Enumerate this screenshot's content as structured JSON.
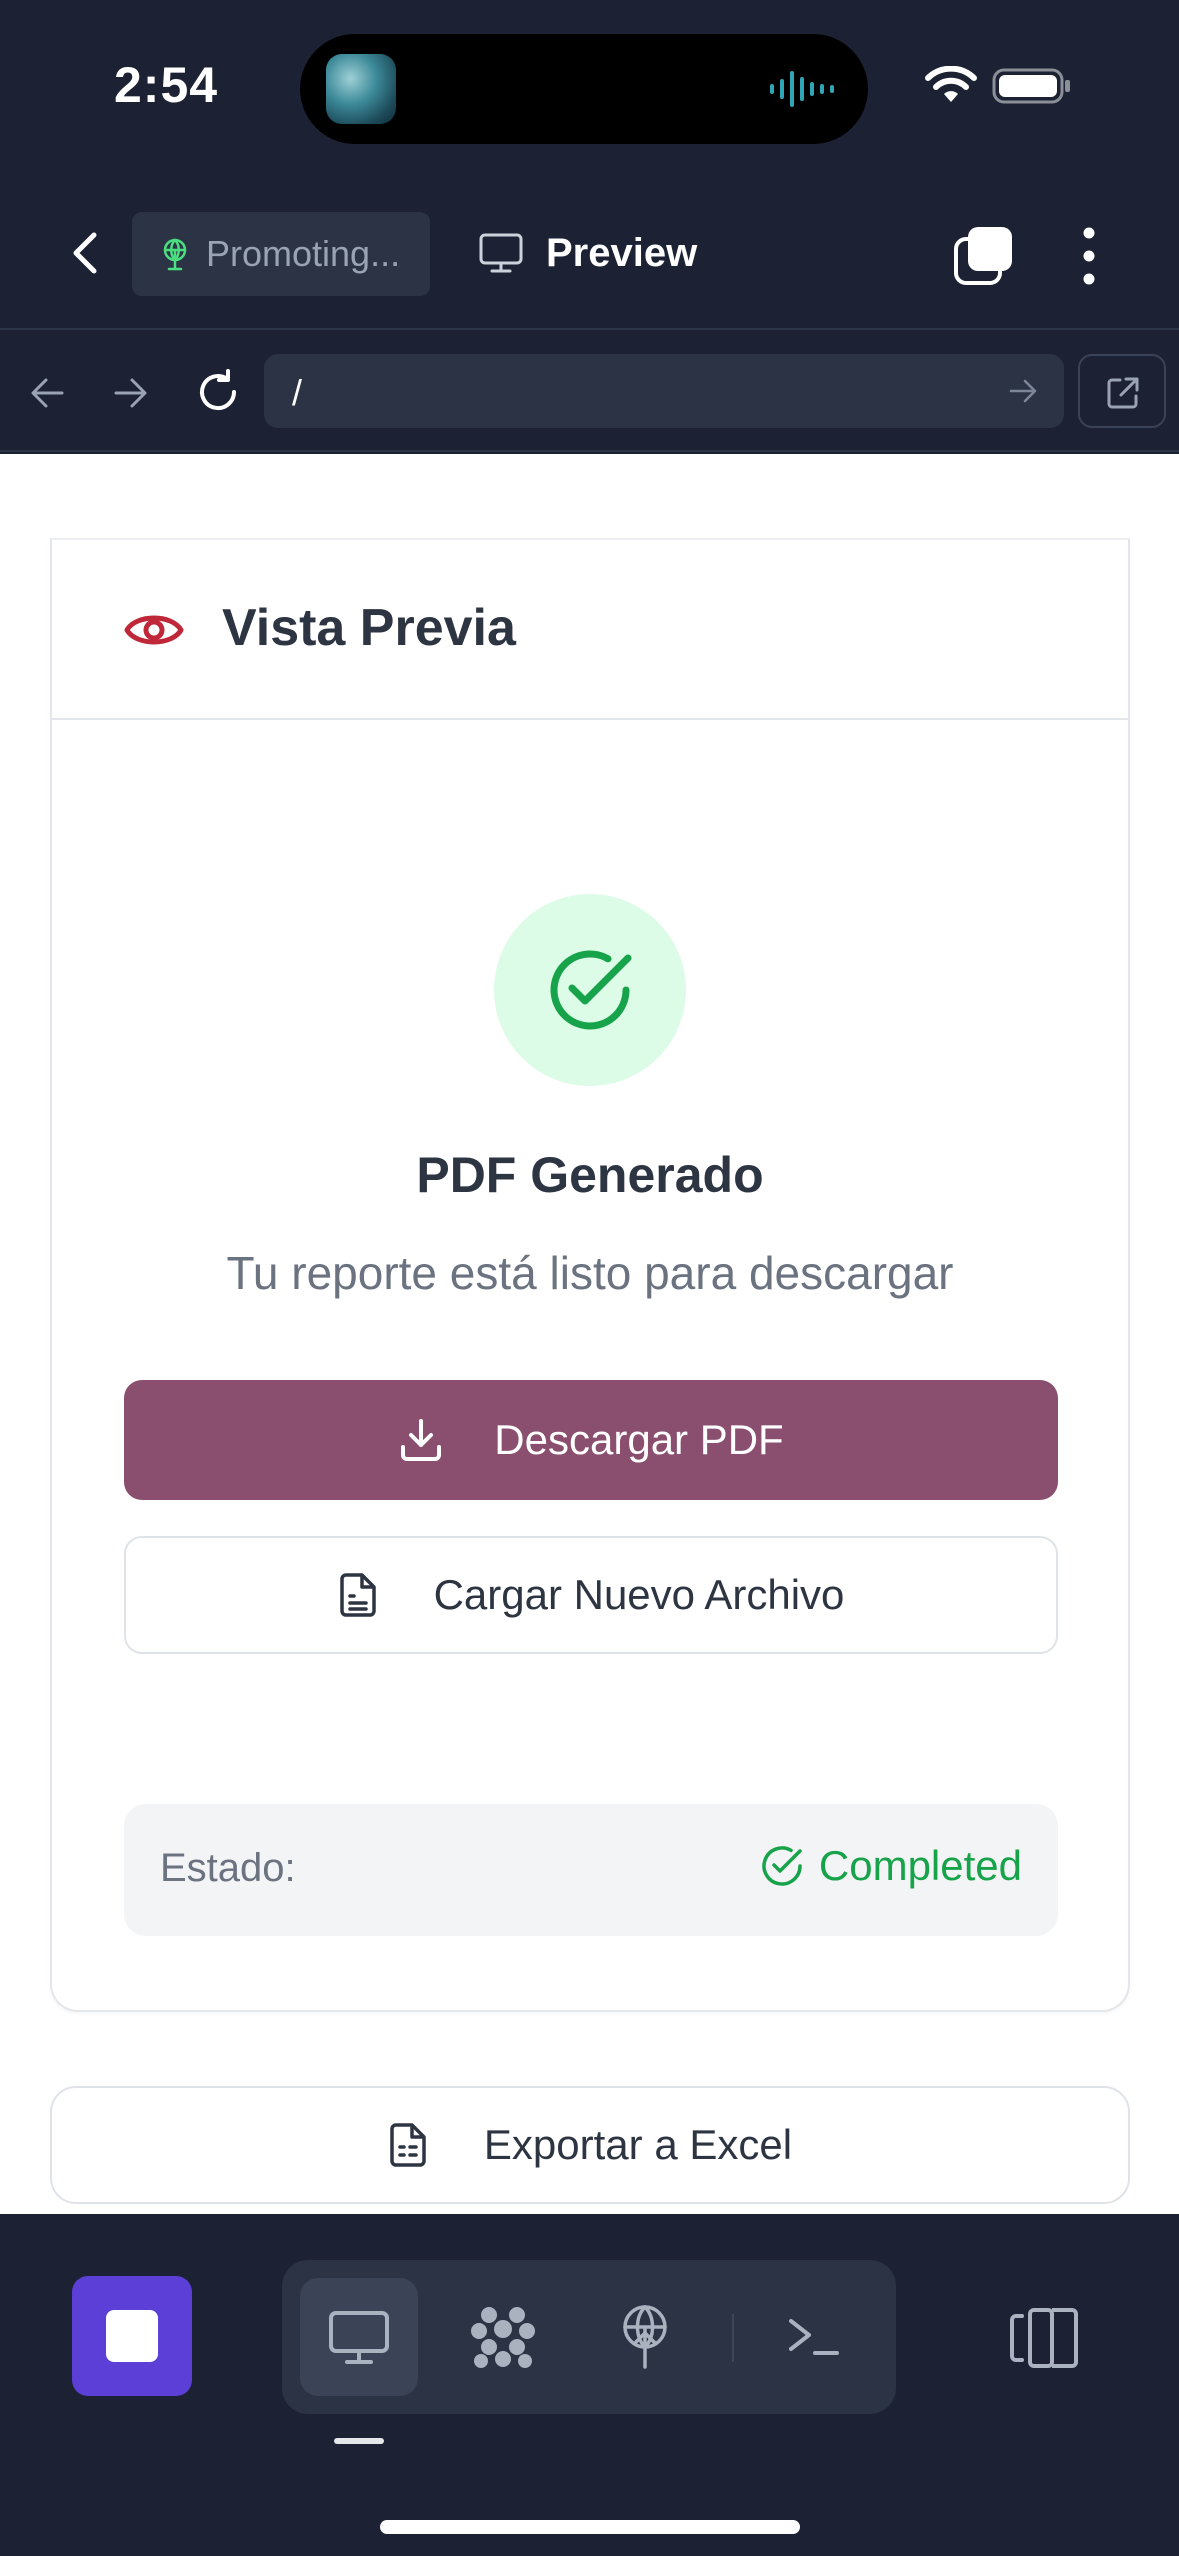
{
  "status_bar": {
    "time": "2:54"
  },
  "header": {
    "project_chip_label": "Promoting...",
    "preview_tab_label": "Preview"
  },
  "url_bar": {
    "url": "/"
  },
  "card": {
    "title": "Vista Previa",
    "result_title": "PDF Generado",
    "result_subtitle": "Tu reporte está listo para descargar",
    "download_label": "Descargar PDF",
    "upload_label": "Cargar Nuevo Archivo",
    "status_label": "Estado:",
    "status_value": "Completed"
  },
  "export_excel_label": "Exportar a Excel",
  "colors": {
    "app_background": "#1c2233",
    "primary_button": "#8a4f6f",
    "success": "#16a34a",
    "success_bg": "#dcfce7",
    "accent_eye": "#c0283a",
    "stop_button": "#5b3fd6"
  },
  "icons": [
    "back-icon",
    "antenna-icon",
    "monitor-icon",
    "windows-icon",
    "more-icon",
    "arrow-left-icon",
    "arrow-right-icon",
    "reload-icon",
    "go-arrow-icon",
    "external-link-icon",
    "eye-icon",
    "check-circle-icon",
    "download-icon",
    "file-icon",
    "file-spreadsheet-icon",
    "stop-icon",
    "desktop-icon",
    "cluster-icon",
    "antenna-icon",
    "terminal-icon",
    "device-toggle-icon"
  ]
}
